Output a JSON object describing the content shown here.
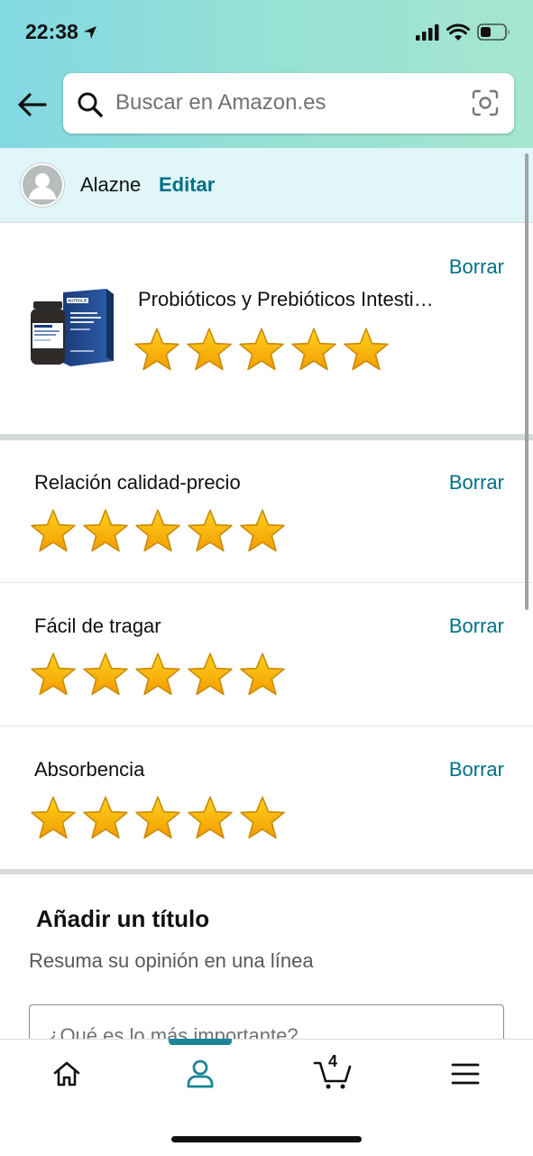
{
  "status_bar": {
    "time": "22:38"
  },
  "search": {
    "placeholder": "Buscar en Amazon.es"
  },
  "user": {
    "name": "Alazne",
    "edit_label": "Editar"
  },
  "product": {
    "title": "Probióticos y Prebióticos Intesti…",
    "image_brand": "NUTRALIE",
    "rating": 5,
    "delete_label": "Borrar"
  },
  "attributes": [
    {
      "label": "Relación calidad-precio",
      "rating": 5,
      "delete_label": "Borrar"
    },
    {
      "label": "Fácil de tragar",
      "rating": 5,
      "delete_label": "Borrar"
    },
    {
      "label": "Absorbencia",
      "rating": 5,
      "delete_label": "Borrar"
    }
  ],
  "review_title": {
    "heading": "Añadir un título",
    "subheading": "Resuma su opinión en una línea",
    "placeholder": "¿Qué es lo más importante?"
  },
  "tabbar": {
    "active": "profile",
    "cart_count": "4"
  },
  "colors": {
    "link": "#007185",
    "star": "#f7b500",
    "header_start": "#82d8e3",
    "header_end": "#a5e6cf",
    "user_bar": "#e0f6f8",
    "tab_active": "#1a8597"
  }
}
